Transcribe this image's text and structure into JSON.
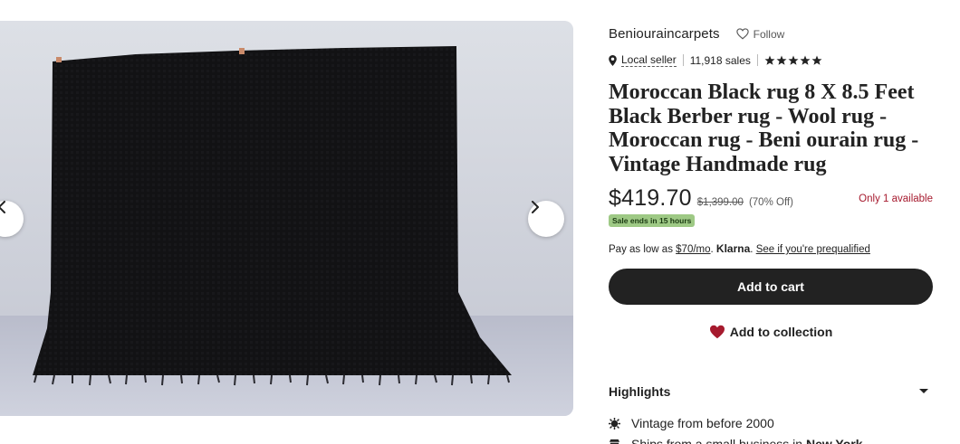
{
  "gallery": {
    "image_alt": "Black shaggy Moroccan rug photographed against a wall",
    "prev_icon": "chevron-left-icon",
    "next_icon": "chevron-right-icon"
  },
  "shop": {
    "name": "Beniouraincarpets",
    "follow_label": "Follow",
    "follow_icon": "heart-outline-icon",
    "local_seller_label": "Local seller",
    "sales_text": "11,918 sales",
    "rating": 5
  },
  "listing": {
    "title": "Moroccan Black rug 8 X 8.5 Feet Black Berber rug - Wool rug - Moroccan rug - Beni ourain rug - Vintage Handmade rug",
    "price": "$419.70",
    "original_price": "$1,399.00",
    "discount": "(70% Off)",
    "availability": "Only 1 available",
    "sale_badge": "Sale ends in 15 hours"
  },
  "klarna": {
    "prefix": "Pay as low as",
    "amount": "$70/mo",
    "dot": ".",
    "brand": "Klarna",
    "brand_dot": ".",
    "link": "See if you're prequalified"
  },
  "actions": {
    "cart_label": "Add to cart",
    "collection_label": "Add to collection"
  },
  "highlights": {
    "label": "Highlights",
    "items": [
      {
        "text": "Vintage from before 2000",
        "icon": "vintage-icon"
      },
      {
        "prefix": "Ships from a small business in",
        "place": "New York",
        "icon": "shop-icon"
      }
    ]
  },
  "colors": {
    "primary_button": "#222222",
    "availability": "#a61a2e",
    "sale_badge": "#9ec985",
    "heart": "#a61a2e"
  }
}
